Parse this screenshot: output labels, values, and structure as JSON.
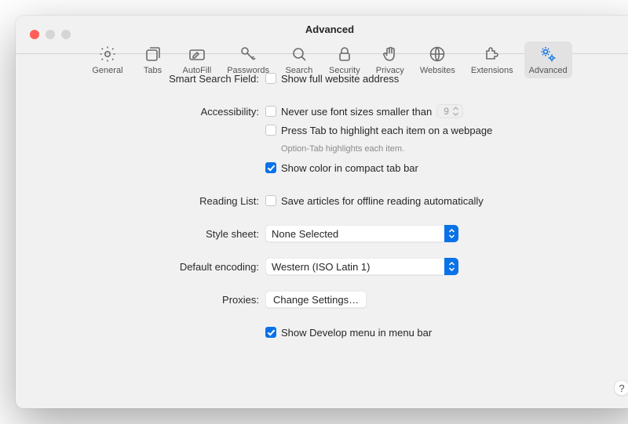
{
  "window": {
    "title": "Advanced"
  },
  "toolbar": {
    "items": [
      {
        "key": "general",
        "label": "General"
      },
      {
        "key": "tabs",
        "label": "Tabs"
      },
      {
        "key": "autofill",
        "label": "AutoFill"
      },
      {
        "key": "passwords",
        "label": "Passwords"
      },
      {
        "key": "search",
        "label": "Search"
      },
      {
        "key": "security",
        "label": "Security"
      },
      {
        "key": "privacy",
        "label": "Privacy"
      },
      {
        "key": "websites",
        "label": "Websites"
      },
      {
        "key": "extensions",
        "label": "Extensions"
      },
      {
        "key": "advanced",
        "label": "Advanced"
      }
    ],
    "active": "advanced"
  },
  "sections": {
    "smartSearch": {
      "label": "Smart Search Field:",
      "showFullAddress": {
        "label": "Show full website address",
        "checked": false
      }
    },
    "accessibility": {
      "label": "Accessibility:",
      "neverSmaller": {
        "label": "Never use font sizes smaller than",
        "checked": false,
        "value": "9"
      },
      "pressTab": {
        "label": "Press Tab to highlight each item on a webpage",
        "checked": false,
        "hint": "Option-Tab highlights each item."
      },
      "showColor": {
        "label": "Show color in compact tab bar",
        "checked": true
      }
    },
    "readingList": {
      "label": "Reading List:",
      "saveOffline": {
        "label": "Save articles for offline reading automatically",
        "checked": false
      }
    },
    "styleSheet": {
      "label": "Style sheet:",
      "value": "None Selected"
    },
    "defaultEncoding": {
      "label": "Default encoding:",
      "value": "Western (ISO Latin 1)"
    },
    "proxies": {
      "label": "Proxies:",
      "button": "Change Settings…"
    },
    "developMenu": {
      "label": "Show Develop menu in menu bar",
      "checked": true
    }
  },
  "help": "?"
}
